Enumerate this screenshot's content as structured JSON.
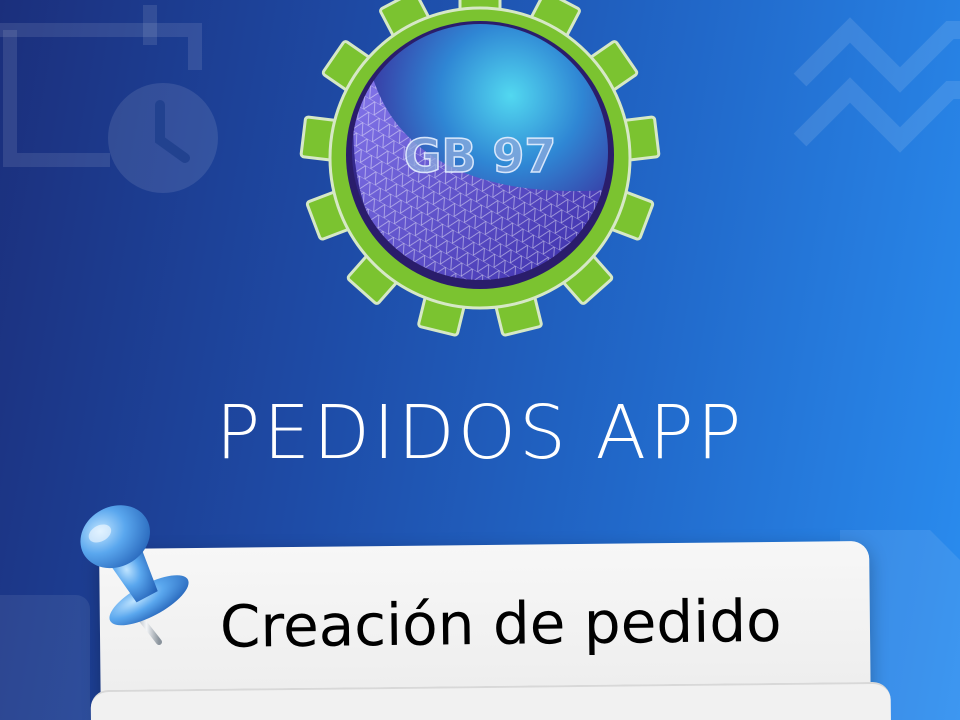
{
  "logo": {
    "text": "GB 97",
    "gear_color": "#7bc330",
    "globe_color": "#4a3fb5"
  },
  "app_name": "PEDIDOS APP",
  "note": {
    "title": "Creación de pedido"
  },
  "colors": {
    "background_start": "#1b2f7c",
    "background_end": "#2a8df0",
    "card": "#f2f2f2",
    "pin": "#4a90e2"
  },
  "icons": [
    "calendar-clock-icon",
    "trend-chart-icon",
    "document-icon",
    "pushpin-icon"
  ]
}
